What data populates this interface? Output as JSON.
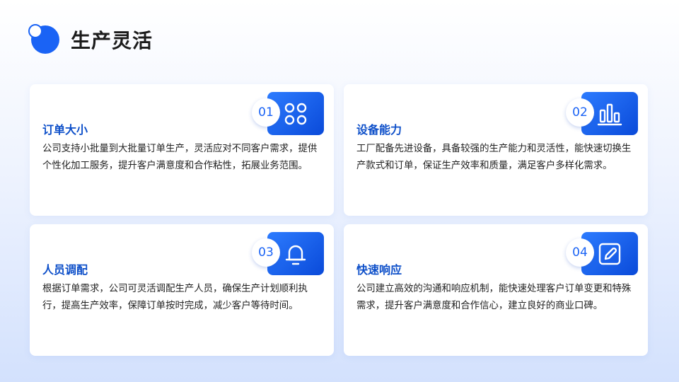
{
  "page": {
    "title": "生产灵活"
  },
  "cards": [
    {
      "number": "01",
      "title": "订单大小",
      "text": "公司支持小批量到大批量订单生产，灵活应对不同客户需求，提供个性化加工服务，提升客户满意度和合作粘性，拓展业务范围。",
      "icon": "command-icon"
    },
    {
      "number": "02",
      "title": "设备能力",
      "text": "工厂配备先进设备，具备较强的生产能力和灵活性，能快速切换生产款式和订单，保证生产效率和质量，满足客户多样化需求。",
      "icon": "bar-chart-icon"
    },
    {
      "number": "03",
      "title": "人员调配",
      "text": "根据订单需求，公司可灵活调配生产人员，确保生产计划顺利执行，提高生产效率，保障订单按时完成，减少客户等待时间。",
      "icon": "bell-icon"
    },
    {
      "number": "04",
      "title": "快速响应",
      "text": "公司建立高效的沟通和响应机制，能快速处理客户订单变更和特殊需求，提升客户满意度和合作信心，建立良好的商业口碑。",
      "icon": "edit-icon"
    }
  ],
  "colors": {
    "accent": "#1a63f5",
    "title": "#0d4fc9"
  }
}
